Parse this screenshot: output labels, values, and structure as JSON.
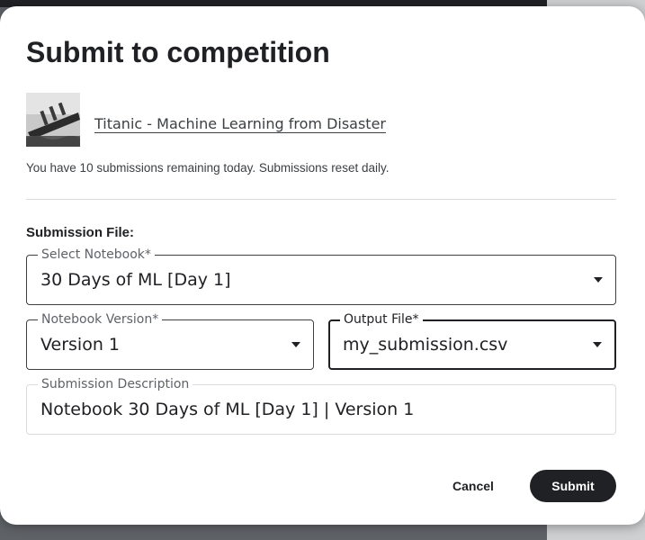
{
  "dialog": {
    "title": "Submit to competition",
    "competition": {
      "name": "Titanic - Machine Learning from Disaster",
      "thumbnail_icon": "titanic-ship-image"
    },
    "remaining_text": "You have 10 submissions remaining today. Submissions reset daily.",
    "section_label": "Submission File:",
    "fields": {
      "notebook": {
        "label": "Select Notebook*",
        "value": "30 Days of ML [Day 1]"
      },
      "version": {
        "label": "Notebook Version*",
        "value": "Version 1"
      },
      "output": {
        "label": "Output File*",
        "value": "my_submission.csv"
      },
      "description": {
        "label": "Submission Description",
        "value": "Notebook 30 Days of ML [Day 1] | Version 1"
      }
    },
    "buttons": {
      "cancel": "Cancel",
      "submit": "Submit"
    }
  },
  "colors": {
    "primary": "#202124",
    "text": "#3c4043",
    "muted": "#5f6368",
    "divider": "#dadce0"
  }
}
